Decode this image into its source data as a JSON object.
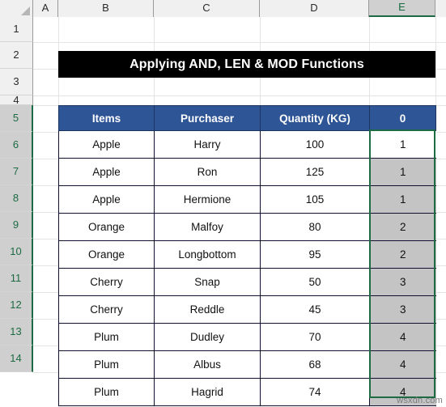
{
  "app": {
    "type": "spreadsheet",
    "watermark": "wsxdn.com"
  },
  "colors": {
    "header_blue": "#2e5595",
    "banner_black": "#000000",
    "selection_green": "#1d6b42",
    "selected_cell_gray": "#c4c4c4",
    "header_strip_gray": "#f0f0f0"
  },
  "columns": [
    {
      "label": "A",
      "selected": false
    },
    {
      "label": "B",
      "selected": false
    },
    {
      "label": "C",
      "selected": false
    },
    {
      "label": "D",
      "selected": false
    },
    {
      "label": "E",
      "selected": true
    }
  ],
  "rows": [
    {
      "label": "1",
      "selected": false
    },
    {
      "label": "2",
      "selected": false
    },
    {
      "label": "3",
      "selected": false
    },
    {
      "label": "4",
      "selected": false
    },
    {
      "label": "5",
      "selected": true
    },
    {
      "label": "6",
      "selected": true
    },
    {
      "label": "7",
      "selected": true
    },
    {
      "label": "8",
      "selected": true
    },
    {
      "label": "9",
      "selected": true
    },
    {
      "label": "10",
      "selected": true
    },
    {
      "label": "11",
      "selected": true
    },
    {
      "label": "12",
      "selected": true
    },
    {
      "label": "13",
      "selected": true
    },
    {
      "label": "14",
      "selected": true
    }
  ],
  "banner": {
    "title": "Applying AND, LEN & MOD Functions"
  },
  "table": {
    "headers": [
      "Items",
      "Purchaser",
      "Quantity (KG)",
      "0"
    ],
    "rows": [
      {
        "items": "Apple",
        "purchaser": "Harry",
        "quantity": "100",
        "result": "1",
        "active": true
      },
      {
        "items": "Apple",
        "purchaser": "Ron",
        "quantity": "125",
        "result": "1",
        "active": false
      },
      {
        "items": "Apple",
        "purchaser": "Hermione",
        "quantity": "105",
        "result": "1",
        "active": false
      },
      {
        "items": "Orange",
        "purchaser": "Malfoy",
        "quantity": "80",
        "result": "2",
        "active": false
      },
      {
        "items": "Orange",
        "purchaser": "Longbottom",
        "quantity": "95",
        "result": "2",
        "active": false
      },
      {
        "items": "Cherry",
        "purchaser": "Snap",
        "quantity": "50",
        "result": "3",
        "active": false
      },
      {
        "items": "Cherry",
        "purchaser": "Reddle",
        "quantity": "45",
        "result": "3",
        "active": false
      },
      {
        "items": "Plum",
        "purchaser": "Dudley",
        "quantity": "70",
        "result": "4",
        "active": false
      },
      {
        "items": "Plum",
        "purchaser": "Albus",
        "quantity": "68",
        "result": "4",
        "active": false
      },
      {
        "items": "Plum",
        "purchaser": "Hagrid",
        "quantity": "74",
        "result": "4",
        "active": false
      }
    ]
  }
}
